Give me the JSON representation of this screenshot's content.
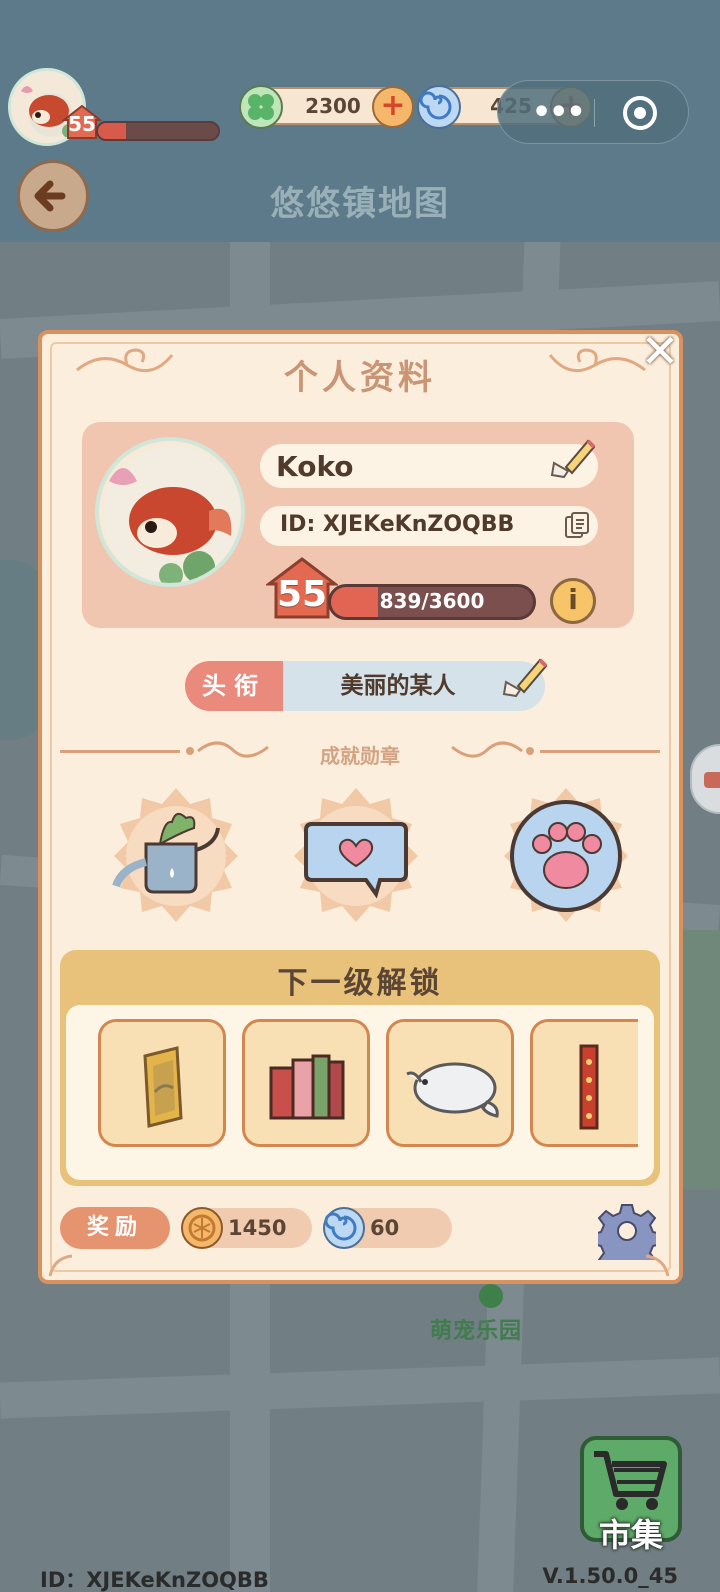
{
  "header": {
    "player_level": "55",
    "player_xp_fraction": 0.23,
    "clover_currency": "2300",
    "swirl_currency": "425",
    "capsule_menu_icon": "more-dots-icon",
    "capsule_close_icon": "target-circle-icon",
    "map_title": "悠悠镇地图"
  },
  "profile": {
    "title": "个人资料",
    "name": "Koko",
    "id": "ID: XJEKeKnZOQBB",
    "level": "55",
    "xp_text": "839/3600",
    "xp_fraction": 0.233,
    "info_symbol": "i",
    "title_tag": "头衔",
    "title_value": "美丽的某人",
    "achievements_label": "成就勋章",
    "medals": [
      "watering-can-medal-icon",
      "heart-message-medal-icon",
      "paw-print-medal-icon"
    ],
    "unlock_header": "下一级解锁",
    "unlock_items": [
      "painting-icon",
      "books-icon",
      "seal-plush-icon",
      "red-banner-icon"
    ],
    "reward_label": "奖励",
    "reward_coin": "1450",
    "reward_swirl": "60"
  },
  "map": {
    "location_label": "萌宠乐园"
  },
  "market": {
    "label": "市集"
  },
  "footer": {
    "id": "ID：XJEKeKnZOQBB",
    "version": "V.1.50.0_45"
  },
  "colors": {
    "accent_orange": "#d9925e",
    "panel_bg": "#fbeedd",
    "header_bg": "#5c7a89",
    "xp_red": "#e26452",
    "market_green": "#5eaa68"
  }
}
